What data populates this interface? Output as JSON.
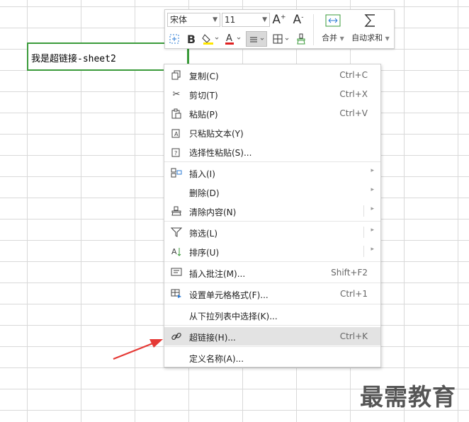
{
  "cell": {
    "text": "我是超链接-sheet2"
  },
  "toolbar": {
    "font_name": "宋体",
    "font_size": "11",
    "increase_font": "A+",
    "decrease_font": "A-",
    "bold": "B",
    "merge_label": "合并",
    "autosum_label": "自动求和",
    "font_color": "#e02020",
    "fill_color": "#ffe600"
  },
  "menu": {
    "items": [
      {
        "label": "复制(C)",
        "shortcut": "Ctrl+C"
      },
      {
        "label": "剪切(T)",
        "shortcut": "Ctrl+X"
      },
      {
        "label": "粘贴(P)",
        "shortcut": "Ctrl+V"
      },
      {
        "label": "只粘贴文本(Y)",
        "shortcut": ""
      },
      {
        "label": "选择性粘贴(S)...",
        "shortcut": ""
      },
      {
        "label": "插入(I)",
        "shortcut": ""
      },
      {
        "label": "删除(D)",
        "shortcut": ""
      },
      {
        "label": "清除内容(N)",
        "shortcut": ""
      },
      {
        "label": "筛选(L)",
        "shortcut": ""
      },
      {
        "label": "排序(U)",
        "shortcut": ""
      },
      {
        "label": "插入批注(M)...",
        "shortcut": "Shift+F2"
      },
      {
        "label": "设置单元格格式(F)...",
        "shortcut": "Ctrl+1"
      },
      {
        "label": "从下拉列表中选择(K)...",
        "shortcut": ""
      },
      {
        "label": "超链接(H)...",
        "shortcut": "Ctrl+K"
      },
      {
        "label": "定义名称(A)...",
        "shortcut": ""
      }
    ]
  },
  "watermark": "最需教育",
  "colors": {
    "selection_border": "#3b9b3b",
    "arrow": "#e53935",
    "highlight": "#e3e3e3"
  }
}
